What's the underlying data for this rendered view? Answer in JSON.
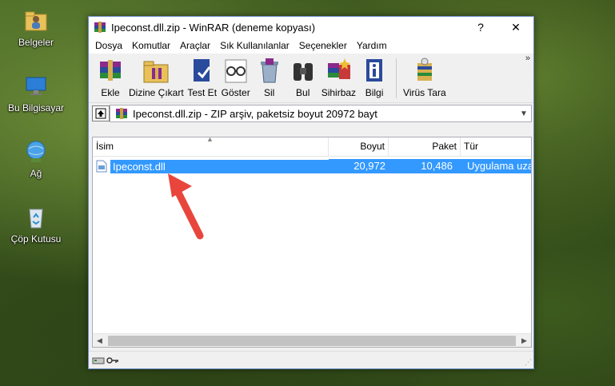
{
  "desktop": {
    "icons": [
      {
        "label": "Belgeler",
        "icon": "folder-user-icon"
      },
      {
        "label": "Bu Bilgisayar",
        "icon": "computer-icon"
      },
      {
        "label": "Ağ",
        "icon": "network-globe-icon"
      },
      {
        "label": "Çöp Kutusu",
        "icon": "recycle-bin-icon"
      }
    ]
  },
  "window": {
    "title": "Ipeconst.dll.zip - WinRAR (deneme kopyası)",
    "help_label": "?",
    "close_label": "✕"
  },
  "menu": [
    "Dosya",
    "Komutlar",
    "Araçlar",
    "Sık Kullanılanlar",
    "Seçenekler",
    "Yardım"
  ],
  "toolbar": {
    "buttons": [
      {
        "label": "Ekle",
        "icon": "add-archive-icon"
      },
      {
        "label": "Dizine Çıkart",
        "icon": "extract-folder-icon"
      },
      {
        "label": "Test Et",
        "icon": "test-archive-icon"
      },
      {
        "label": "Göster",
        "icon": "view-glasses-icon"
      },
      {
        "label": "Sil",
        "icon": "delete-icon"
      },
      {
        "label": "Bul",
        "icon": "find-binoculars-icon"
      },
      {
        "label": "Sihirbaz",
        "icon": "wizard-icon"
      },
      {
        "label": "Bilgi",
        "icon": "info-icon"
      },
      {
        "label": "Virüs Tara",
        "icon": "virus-scan-icon"
      }
    ],
    "more": "»"
  },
  "pathbar": {
    "text": "Ipeconst.dll.zip - ZIP arşiv, paketsiz boyut 20972 bayt"
  },
  "filelist": {
    "columns": [
      "İsim",
      "Boyut",
      "Paket",
      "Tür"
    ],
    "rows": [
      {
        "name": "Ipeconst.dll",
        "size": "20,972",
        "packed": "10,486",
        "type": "Uygulama uza"
      }
    ]
  },
  "colors": {
    "selection": "#3399ff",
    "arrow": "#e8453c"
  }
}
